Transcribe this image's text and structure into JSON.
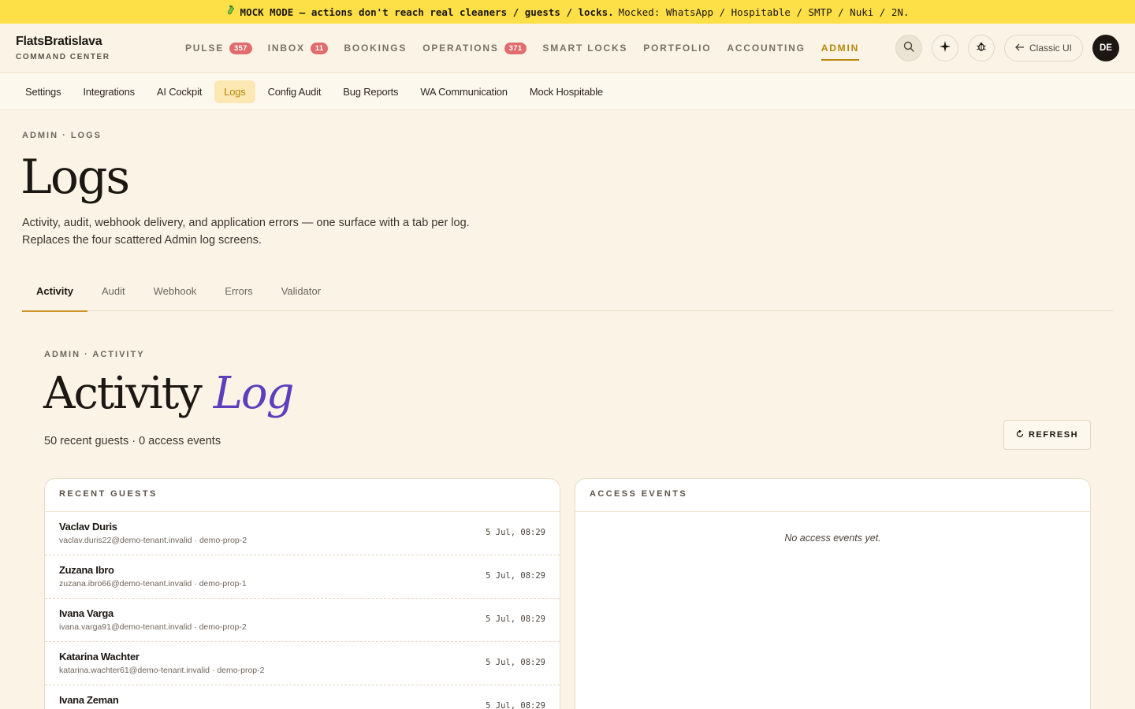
{
  "banner": {
    "icon": "test-tube-icon",
    "strong_text": "MOCK MODE — actions don't reach real cleaners / guests / locks.",
    "rest_text": "Mocked: WhatsApp / Hospitable / SMTP / Nuki / 2N."
  },
  "brand": {
    "name": "FlatsBratislava",
    "subtitle": "COMMAND CENTER"
  },
  "nav": [
    {
      "label": "PULSE",
      "badge": "357"
    },
    {
      "label": "INBOX",
      "badge": "11"
    },
    {
      "label": "BOOKINGS",
      "badge": ""
    },
    {
      "label": "OPERATIONS",
      "badge": "371"
    },
    {
      "label": "SMART LOCKS",
      "badge": ""
    },
    {
      "label": "PORTFOLIO",
      "badge": ""
    },
    {
      "label": "ACCOUNTING",
      "badge": ""
    },
    {
      "label": "ADMIN",
      "badge": ""
    }
  ],
  "nav_right": {
    "classic_label": "Classic UI",
    "avatar_initials": "DE"
  },
  "subnav": [
    "Settings",
    "Integrations",
    "AI Cockpit",
    "Logs",
    "Config Audit",
    "Bug Reports",
    "WA Communication",
    "Mock Hospitable"
  ],
  "page": {
    "eyebrow": "ADMIN · LOGS",
    "title": "Logs",
    "description_line1": "Activity, audit, webhook delivery, and application errors — one surface with a tab per log.",
    "description_line2": "Replaces the four scattered Admin log screens."
  },
  "tabs": [
    "Activity",
    "Audit",
    "Webhook",
    "Errors",
    "Validator"
  ],
  "activity": {
    "eyebrow": "ADMIN · ACTIVITY",
    "title_main": "Activity",
    "title_accent": "Log",
    "summary": "50 recent guests · 0 access events",
    "refresh_label": "REFRESH"
  },
  "recent_guests": {
    "header": "RECENT GUESTS",
    "rows": [
      {
        "name": "Vaclav Duris",
        "meta": "vaclav.duris22@demo-tenant.invalid · demo-prop-2",
        "time": "5 Jul, 08:29"
      },
      {
        "name": "Zuzana Ibro",
        "meta": "zuzana.ibro66@demo-tenant.invalid · demo-prop-1",
        "time": "5 Jul, 08:29"
      },
      {
        "name": "Ivana Varga",
        "meta": "ivana.varga91@demo-tenant.invalid · demo-prop-2",
        "time": "5 Jul, 08:29"
      },
      {
        "name": "Katarina Wachter",
        "meta": "katarina.wachter61@demo-tenant.invalid · demo-prop-2",
        "time": "5 Jul, 08:29"
      },
      {
        "name": "Ivana Zeman",
        "meta": "",
        "time": "5 Jul, 08:29"
      }
    ]
  },
  "access_events": {
    "header": "ACCESS EVENTS",
    "empty_text": "No access events yet."
  }
}
